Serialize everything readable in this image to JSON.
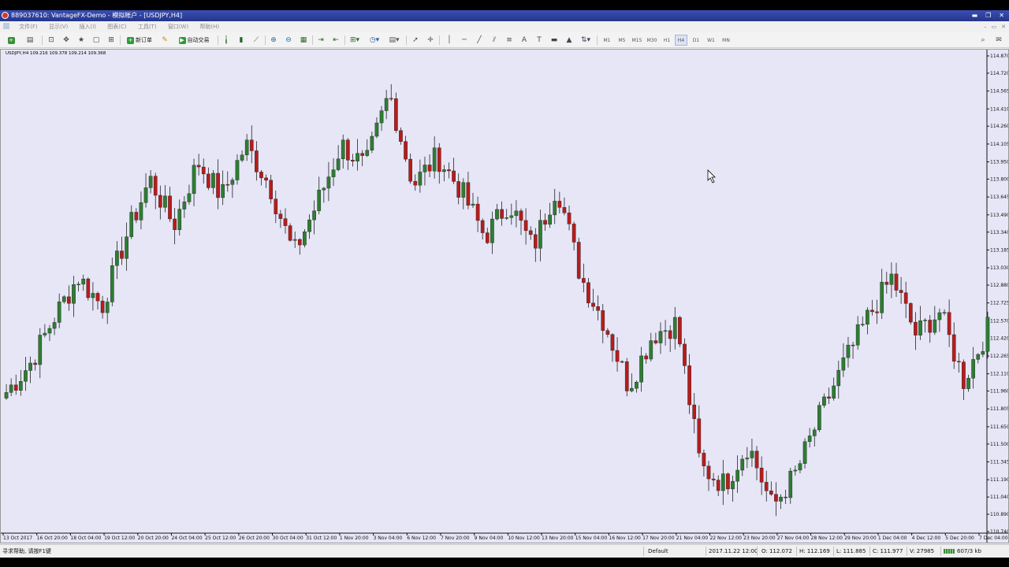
{
  "window": {
    "title": "889037610: VantageFX-Demo - 模拟帐户 - [USDJPY,H4]",
    "minimize": "▬",
    "restore": "❐",
    "close": "✕"
  },
  "menu": {
    "items": [
      "文件(F)",
      "显示(V)",
      "插入(I)",
      "图表(C)",
      "工具(T)",
      "窗口(W)",
      "帮助(H)"
    ],
    "mdi_minimize": "–",
    "mdi_restore": "▭",
    "mdi_close": "✕"
  },
  "toolbar": {
    "new_order_label": "新订单",
    "auto_trade_label": "自动交易",
    "timeframes": [
      "M1",
      "M5",
      "M15",
      "M30",
      "H1",
      "H4",
      "D1",
      "W1",
      "MN"
    ],
    "active_timeframe": "H4",
    "accent": "#2f9a3a"
  },
  "chart": {
    "symbol_info": "USDJPY,H4  109.216 109.378 109.214 109.368",
    "background": "#e6e6f7",
    "bull_color": "#2e7d32",
    "bear_color": "#b71c1c",
    "price_ticks": [
      "114.870",
      "114.720",
      "114.565",
      "114.410",
      "114.260",
      "114.105",
      "113.950",
      "113.800",
      "113.645",
      "113.490",
      "113.340",
      "113.185",
      "113.030",
      "112.880",
      "112.725",
      "112.570",
      "112.420",
      "112.265",
      "112.110",
      "111.960",
      "111.805",
      "111.650",
      "111.500",
      "111.345",
      "111.190",
      "111.040",
      "110.890",
      "110.740"
    ],
    "time_ticks": [
      "13 Oct 2017",
      "16 Oct 20:00",
      "18 Oct 04:00",
      "19 Oct 12:00",
      "20 Oct 20:00",
      "24 Oct 04:00",
      "25 Oct 12:00",
      "26 Oct 20:00",
      "30 Oct 04:00",
      "31 Oct 12:00",
      "1 Nov 20:00",
      "3 Nov 04:00",
      "6 Nov 12:00",
      "7 Nov 20:00",
      "9 Nov 04:00",
      "10 Nov 12:00",
      "13 Nov 20:00",
      "15 Nov 04:00",
      "16 Nov 12:00",
      "17 Nov 20:00",
      "21 Nov 04:00",
      "22 Nov 12:00",
      "23 Nov 20:00",
      "27 Nov 04:00",
      "28 Nov 12:00",
      "29 Nov 20:00",
      "1 Dec 04:00",
      "4 Dec 12:00",
      "5 Dec 20:00",
      "7 Dec 04:00"
    ]
  },
  "chart_data": {
    "type": "candlestick",
    "symbol": "USDJPY",
    "timeframe": "H4",
    "ylim": [
      110.74,
      114.87
    ],
    "anchors": [
      111.95,
      112.2,
      112.6,
      112.95,
      112.7,
      113.3,
      113.8,
      113.4,
      113.95,
      113.65,
      114.1,
      113.75,
      113.15,
      113.6,
      114.1,
      113.9,
      114.55,
      113.75,
      114.0,
      113.7,
      113.3,
      113.6,
      113.2,
      113.75,
      112.95,
      112.55,
      112.0,
      112.45,
      112.55,
      111.3,
      111.15,
      111.5,
      110.95,
      111.25,
      111.75,
      112.2,
      112.6,
      112.95,
      112.45,
      112.65,
      112.05,
      112.5
    ]
  },
  "status": {
    "help": "寻求帮助, 请按F1键",
    "profile": "Default",
    "time": "2017.11.22 12:00",
    "open": "O: 112.072",
    "high": "H: 112.169",
    "low": "L: 111.885",
    "close": "C: 111.977",
    "volume": "V: 27985",
    "traffic": "607/3 kb"
  }
}
